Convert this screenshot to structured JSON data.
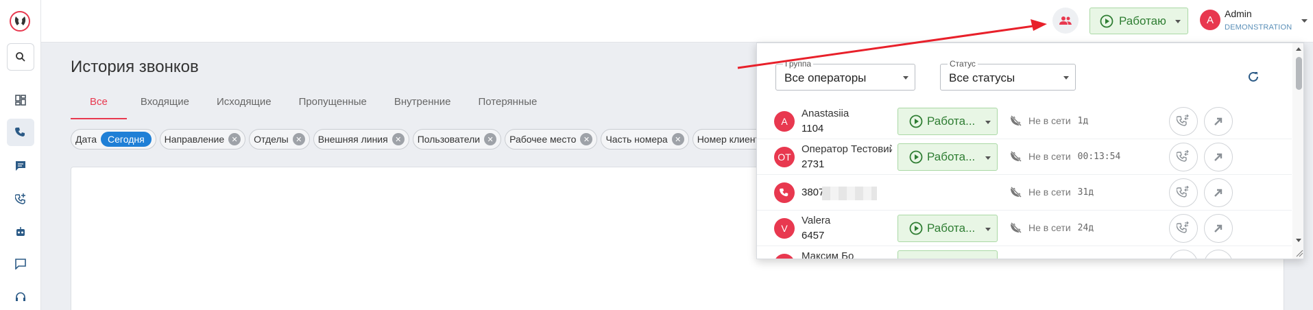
{
  "topbar": {
    "status_label": "Работаю",
    "user_initial": "A",
    "user_name": "Admin",
    "user_org": "DEMONSTRATION"
  },
  "page": {
    "title": "История звонков",
    "tabs": [
      "Все",
      "Входящие",
      "Исходящие",
      "Пропущенные",
      "Внутренние",
      "Потерянные"
    ]
  },
  "filters": {
    "date_label": "Дата",
    "date_value": "Сегодня",
    "chips": [
      "Направление",
      "Отделы",
      "Внешняя линия",
      "Пользователи",
      "Рабочее место",
      "Часть номера",
      "Номер клиента"
    ]
  },
  "panel": {
    "group_label": "Группа",
    "group_value": "Все операторы",
    "status_label": "Статус",
    "status_value": "Все статусы",
    "operators": [
      {
        "initial": "A",
        "name": "Anastasiia",
        "ext": "1104",
        "status": "Работа...",
        "offline_label": "Не в сети",
        "duration": "1д"
      },
      {
        "initial": "ОТ",
        "name": "Оператор Тестовий",
        "ext": "2731",
        "status": "Работа...",
        "offline_label": "Не в сети",
        "duration": "00:13:54"
      },
      {
        "initial": "",
        "name": "",
        "ext": "3807",
        "status": "",
        "offline_label": "Не в сети",
        "duration": "31д"
      },
      {
        "initial": "V",
        "name": "Valera",
        "ext": "6457",
        "status": "Работа...",
        "offline_label": "Не в сети",
        "duration": "24д"
      },
      {
        "initial": "",
        "name": "Максим Бо",
        "ext": "",
        "status": "",
        "offline_label": "",
        "duration": ""
      }
    ]
  },
  "colors": {
    "accent_red": "#e8384f",
    "status_green": "#2e7d32",
    "status_green_bg": "#e8f6e5",
    "date_chip_blue": "#1f7fd6",
    "annotation_arrow": "#e8202a"
  }
}
